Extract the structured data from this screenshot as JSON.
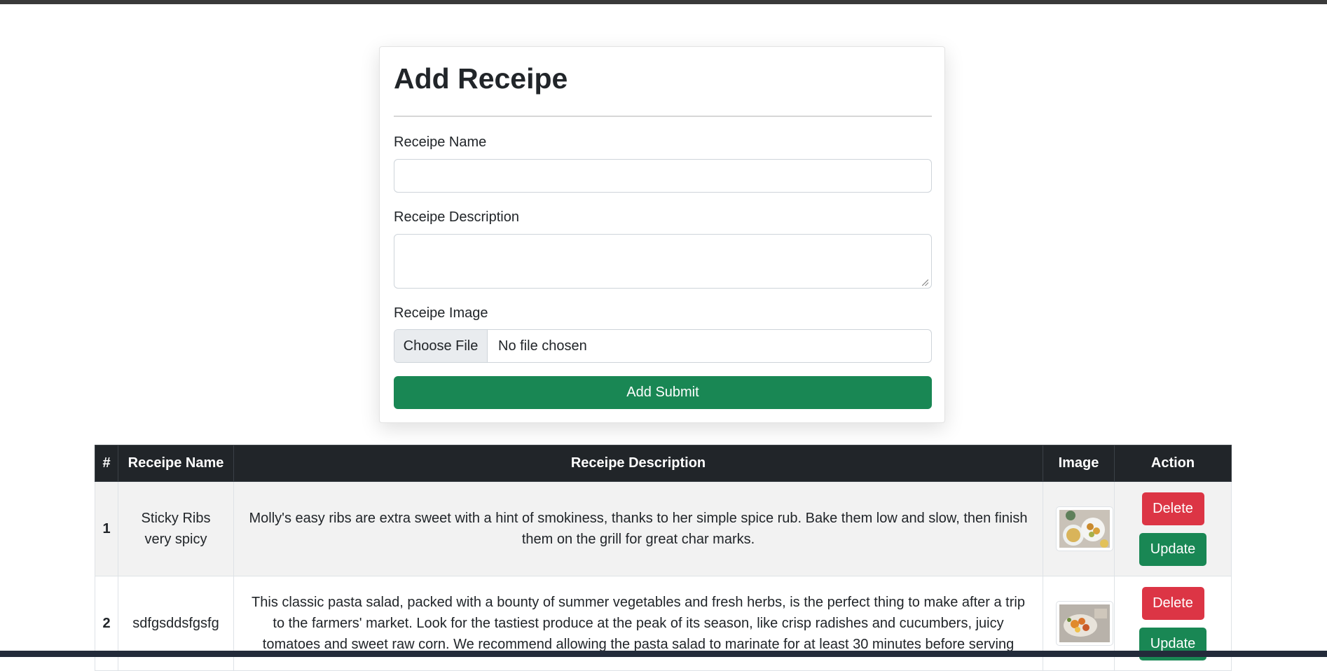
{
  "form": {
    "title": "Add Receipe",
    "name_label": "Receipe Name",
    "name_value": "",
    "description_label": "Receipe Description",
    "description_value": "",
    "image_label": "Receipe Image",
    "file_button_label": "Choose File",
    "file_status": "No file chosen",
    "submit_label": "Add Submit"
  },
  "table": {
    "headers": [
      "#",
      "Receipe Name",
      "Receipe Description",
      "Image",
      "Action"
    ],
    "rows": [
      {
        "num": "1",
        "name": "Sticky Ribs very spicy",
        "description": "Molly's easy ribs are extra sweet with a hint of smokiness, thanks to her simple spice rub. Bake them low and slow, then finish them on the grill for great char marks.",
        "delete_label": "Delete",
        "update_label": "Update"
      },
      {
        "num": "2",
        "name": "sdfgsddsfgsfg",
        "description": "This classic pasta salad, packed with a bounty of summer vegetables and fresh herbs, is the perfect thing to make after a trip to the farmers' market. Look for the tastiest produce at the peak of its season, like crisp radishes and cucumbers, juicy tomatoes and sweet raw corn. We recommend allowing the pasta salad to marinate for at least 30 minutes before serving",
        "delete_label": "Delete",
        "update_label": "Update"
      }
    ]
  },
  "colors": {
    "success": "#198754",
    "danger": "#dc3545",
    "header_bg": "#212529",
    "striped_row": "#f2f2f2"
  }
}
